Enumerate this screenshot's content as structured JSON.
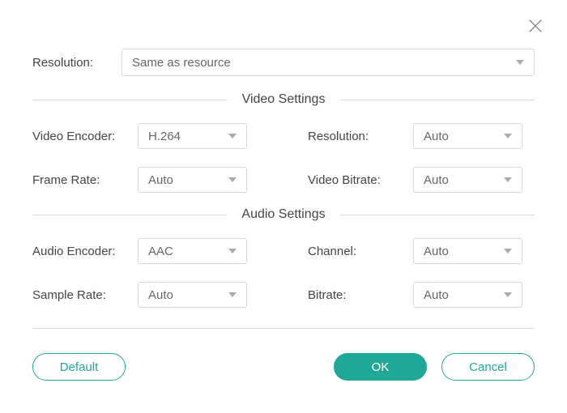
{
  "close_icon": "close",
  "top": {
    "resolution_label": "Resolution:",
    "resolution_value": "Same as resource"
  },
  "video": {
    "section_title": "Video Settings",
    "encoder_label": "Video Encoder:",
    "encoder_value": "H.264",
    "resolution_label": "Resolution:",
    "resolution_value": "Auto",
    "framerate_label": "Frame Rate:",
    "framerate_value": "Auto",
    "bitrate_label": "Video Bitrate:",
    "bitrate_value": "Auto"
  },
  "audio": {
    "section_title": "Audio Settings",
    "encoder_label": "Audio Encoder:",
    "encoder_value": "AAC",
    "channel_label": "Channel:",
    "channel_value": "Auto",
    "samplerate_label": "Sample Rate:",
    "samplerate_value": "Auto",
    "bitrate_label": "Bitrate:",
    "bitrate_value": "Auto"
  },
  "buttons": {
    "default": "Default",
    "ok": "OK",
    "cancel": "Cancel"
  },
  "colors": {
    "accent": "#1fa798"
  }
}
